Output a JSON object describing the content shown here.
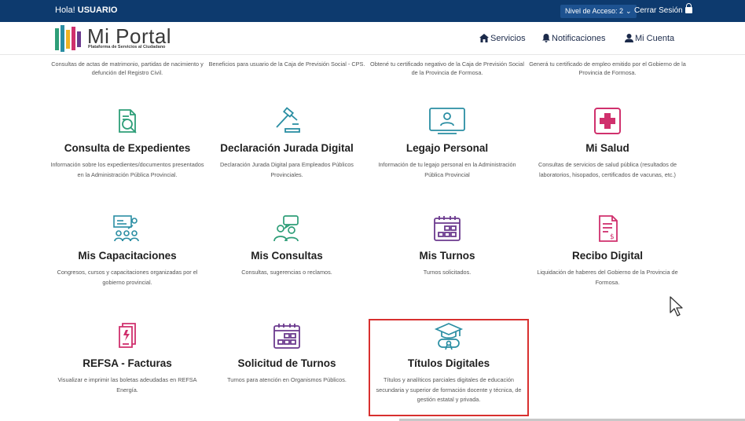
{
  "topbar": {
    "greeting": "Hola!",
    "user": "USUARIO",
    "access_label": "Nivel de Acceso: 2",
    "logout": "Cerrar Sesión"
  },
  "header": {
    "logo_title": "Mi Portal",
    "logo_subtitle": "Plataforma de Servicios al Ciudadano",
    "nav": {
      "services": "Servicios",
      "notifications": "Notificaciones",
      "account": "Mi Cuenta"
    }
  },
  "top_descriptions": [
    "Consultas de actas de matrimonio, partidas de nacimiento y defunción del Registro Civil.",
    "Beneficios para usuario de la Caja de Previsión Social - CPS.",
    "Obtené tu certificado negativo de la Caja de Previsión Social de la Provincia de Formosa.",
    "Generá tu certificado de empleo emitido por el Gobierno de la Provincia de Formosa."
  ],
  "cards": [
    {
      "title": "Consulta de Expedientes",
      "desc": "Información sobre los expedientes/documentos presentados en la Administración Pública Provincial.",
      "icon": "document-search-icon"
    },
    {
      "title": "Declaración Jurada Digital",
      "desc": "Declaración Jurada Digital para Empleados Públicos Provinciales.",
      "icon": "gavel-icon"
    },
    {
      "title": "Legajo Personal",
      "desc": "Información de tu legajo personal en la Administración Pública Provincial",
      "icon": "id-card-icon"
    },
    {
      "title": "Mi Salud",
      "desc": "Consultas de servicios de salud pública (resultados de laboratorios, hisopados, certificados de vacunas, etc.)",
      "icon": "medical-cross-icon"
    },
    {
      "title": "Mis Capacitaciones",
      "desc": "Congresos, cursos y capacitaciones organizadas por el gobierno provincial.",
      "icon": "training-icon"
    },
    {
      "title": "Mis Consultas",
      "desc": "Consultas, sugerencias o reclamos.",
      "icon": "chat-users-icon"
    },
    {
      "title": "Mis Turnos",
      "desc": "Turnos solicitados.",
      "icon": "calendar-icon"
    },
    {
      "title": "Recibo Digital",
      "desc": "Liquidación de haberes del Gobierno de la Provincia de Formosa.",
      "icon": "receipt-icon"
    },
    {
      "title": "REFSA - Facturas",
      "desc": "Visualizar e imprimir las boletas adeudadas en REFSA Energía.",
      "icon": "invoice-icon"
    },
    {
      "title": "Solicitud de Turnos",
      "desc": "Turnos para atención en Organismos Públicos.",
      "icon": "calendar-icon"
    },
    {
      "title": "Títulos Digitales",
      "desc": "Títulos y analíticos parciales digitales de educación secundaria y superior de formación docente y técnica, de gestión estatal y privada.",
      "icon": "graduation-icon"
    }
  ],
  "colors": {
    "topbar": "#0d3a6e",
    "icon_green": "#2e9e78",
    "icon_teal": "#2a8ea3",
    "icon_pink": "#d0306d",
    "icon_purple": "#6b3a8e",
    "highlight": "#d8302f"
  }
}
